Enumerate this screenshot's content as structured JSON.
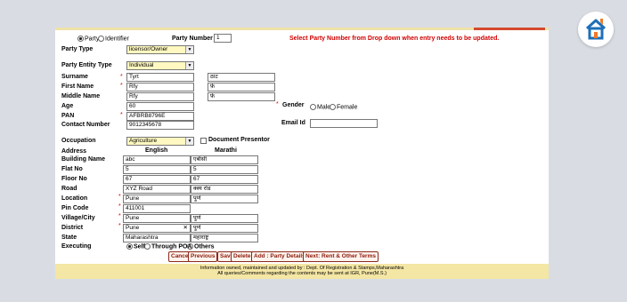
{
  "top": {
    "party_radio": "Party",
    "identifier_radio": "Identifier",
    "party_number_label": "Party Number",
    "party_number_value": "1",
    "hint": "Select Party Number from Drop down when entry needs to be updated."
  },
  "form": {
    "party_type_label": "Party Type",
    "party_type_value": "licensor/Owner",
    "entity_type_label": "Party Entity Type",
    "entity_type_value": "Individual",
    "surname_label": "Surname",
    "surname_en": "Tyrt",
    "surname_mr": "ठाट",
    "first_name_label": "First Name",
    "first_name_en": "Rfy",
    "first_name_mr": "र्फ़",
    "middle_name_label": "Middle Name",
    "middle_name_en": "Rfy",
    "middle_name_mr": "र्फ़",
    "age_label": "Age",
    "age_value": "60",
    "pan_label": "PAN",
    "pan_value": "AFBRB8796E",
    "contact_label": "Contact Number",
    "contact_value": "9012345678",
    "gender_label": "Gender",
    "gender_male": "Male",
    "gender_female": "Female",
    "email_label": "Email Id",
    "email_value": "",
    "occupation_label": "Occupation",
    "occupation_value": "Agriculture",
    "doc_presentor_label": "Document Presentor"
  },
  "address": {
    "heading": "Address",
    "col_english": "English",
    "col_marathi": "Marathi",
    "rows": [
      {
        "label": "Building Name",
        "en": "abc",
        "mr": "एबीसी"
      },
      {
        "label": "Flat No",
        "en": "5",
        "mr": "5"
      },
      {
        "label": "Floor No",
        "en": "67",
        "mr": "67"
      },
      {
        "label": "Road",
        "en": "XYZ Road",
        "mr": "क्स्य रोड"
      },
      {
        "label": "Location",
        "en": "Pune",
        "mr": "पुणे"
      },
      {
        "label": "Pin Code",
        "en": "411001",
        "mr": ""
      },
      {
        "label": "Village/City",
        "en": "Pune",
        "mr": "पुणे"
      },
      {
        "label": "District",
        "en": "Pune",
        "mr": "पुणे"
      },
      {
        "label": "State",
        "en": "Maharashtra",
        "mr": "महाराष्ट्र"
      }
    ]
  },
  "executing": {
    "label": "Executing",
    "self": "Self",
    "through_poa": "Through POA",
    "others": "Others"
  },
  "buttons": {
    "cancel": "Cancel",
    "previous": "Previous",
    "save": "Save",
    "delete": "Delete",
    "add_party": "Add : Party Details",
    "next": "Next: Rent & Other Terms"
  },
  "footer": {
    "line1": "Information owned, maintained and updated by : Dept. Of Registration & Stamps,Maharashtra",
    "line2": "All queries/Comments regarding the contents may be sent at IGR, Pune(M.S.)"
  },
  "colors": {
    "hint_red": "#d00000",
    "select_bg": "#fff8c0",
    "footer_bg": "#f4e6a4",
    "logo_orange": "#f07a2a",
    "logo_blue": "#1d6fb8"
  },
  "icons": [
    "house-logo-icon"
  ]
}
